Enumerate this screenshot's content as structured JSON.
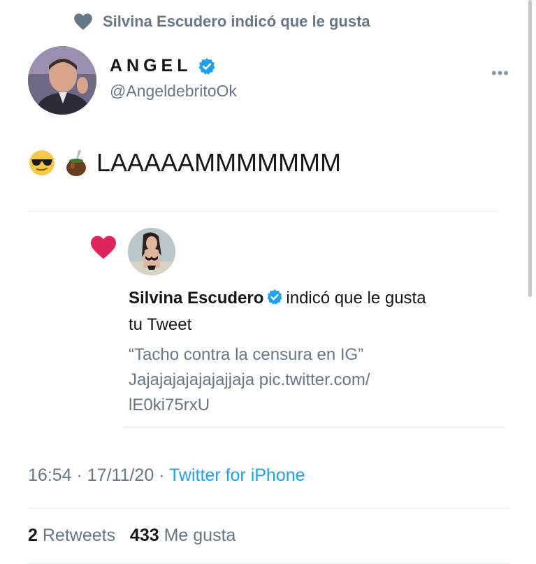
{
  "social_context": {
    "text": "Silvina Escudero indicó que le gusta",
    "icon": "heart-icon"
  },
  "author": {
    "name": "ANGEL",
    "handle": "@AngeldebritoOk",
    "verified": true
  },
  "more_icon": "•••",
  "tweet": {
    "emojis": [
      "sunglasses-emoji",
      "mate-emoji"
    ],
    "text": "LAAAAAMMMMMMM"
  },
  "notification": {
    "name": "Silvina Escudero",
    "action": "indicó que le gusta tu Tweet",
    "quoted_line1": "“Tacho contra la censura en IG”",
    "quoted_line2": "Jajajajajajajajjaja pic.twitter.com/",
    "quoted_line3": "lE0ki75rxU"
  },
  "meta": {
    "time": "16:54",
    "sep1": " · ",
    "date": "17/11/20",
    "sep2": " · ",
    "source": "Twitter for iPhone"
  },
  "stats": {
    "retweets_count": "2",
    "retweets_label": "Retweets",
    "likes_count": "433",
    "likes_label": "Me gusta"
  },
  "colors": {
    "verified_blue": "#1da1f2",
    "like_red": "#e0245e",
    "secondary_text": "#657786"
  }
}
